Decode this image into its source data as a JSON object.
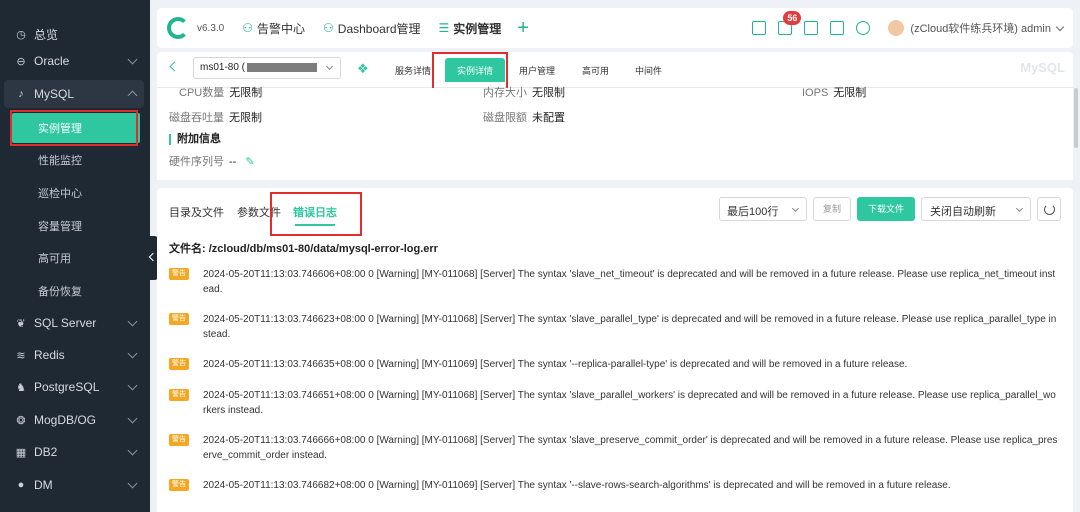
{
  "sidebar": {
    "items": [
      {
        "label": "总览",
        "icon": "dashboard-icon"
      },
      {
        "label": "Oracle",
        "icon": "oracle-icon"
      },
      {
        "label": "MySQL",
        "icon": "mysql-icon"
      },
      {
        "label": "SQL Server",
        "icon": "sqlserver-icon"
      },
      {
        "label": "Redis",
        "icon": "redis-icon"
      },
      {
        "label": "PostgreSQL",
        "icon": "postgresql-icon"
      },
      {
        "label": "MogDB/OG",
        "icon": "mogdb-icon"
      },
      {
        "label": "DB2",
        "icon": "db2-icon"
      },
      {
        "label": "DM",
        "icon": "dm-icon"
      }
    ],
    "mysql_sub": [
      "实例管理",
      "性能监控",
      "巡检中心",
      "容量管理",
      "高可用",
      "备份恢复"
    ]
  },
  "header": {
    "version": "v6.3.0",
    "links": [
      "告警中心",
      "Dashboard管理",
      "实例管理"
    ],
    "notification_count": "56",
    "user": "(zCloud软件练兵环境) admin"
  },
  "tabbar": {
    "instance": "ms01-80 (",
    "tabs": [
      "服务详情",
      "实例详情",
      "用户管理",
      "高可用",
      "中间件"
    ],
    "watermark": "MySQL"
  },
  "info": {
    "cpu_label": "CPU数量",
    "cpu_value": "无限制",
    "mem_label": "内存大小",
    "mem_value": "无限制",
    "iops_label": "IOPS",
    "iops_value": "无限制",
    "disk_label": "磁盘吞吐量",
    "disk_value": "无限制",
    "quota_label": "磁盘限额",
    "quota_value": "未配置",
    "extra_title": "附加信息",
    "serial_label": "硬件序列号",
    "serial_value": "--"
  },
  "log": {
    "tabs": [
      "目录及文件",
      "参数文件",
      "错误日志"
    ],
    "lines_select": "最后100行",
    "copy_label": "复制",
    "download_label": "下载文件",
    "refresh_select": "关闭自动刷新",
    "filename_label": "文件名:",
    "filename": "/zcloud/db/ms01-80/data/mysql-error-log.err",
    "tag": "警告",
    "entries": [
      "2024-05-20T11:13:03.746606+08:00 0 [Warning] [MY-011068] [Server] The syntax 'slave_net_timeout' is deprecated and will be removed in a future release. Please use replica_net_timeout instead.",
      "2024-05-20T11:13:03.746623+08:00 0 [Warning] [MY-011068] [Server] The syntax 'slave_parallel_type' is deprecated and will be removed in a future release. Please use replica_parallel_type instead.",
      "2024-05-20T11:13:03.746635+08:00 0 [Warning] [MY-011069] [Server] The syntax '--replica-parallel-type' is deprecated and will be removed in a future release.",
      "2024-05-20T11:13:03.746651+08:00 0 [Warning] [MY-011068] [Server] The syntax 'slave_parallel_workers' is deprecated and will be removed in a future release. Please use replica_parallel_workers instead.",
      "2024-05-20T11:13:03.746666+08:00 0 [Warning] [MY-011068] [Server] The syntax 'slave_preserve_commit_order' is deprecated and will be removed in a future release. Please use replica_preserve_commit_order instead.",
      "2024-05-20T11:13:03.746682+08:00 0 [Warning] [MY-011069] [Server] The syntax '--slave-rows-search-algorithms' is deprecated and will be removed in a future release."
    ]
  },
  "colors": {
    "accent": "#2ec7a0",
    "sidebar_bg": "#1f2933",
    "warning": "#f5a623",
    "highlight": "#e02e2e"
  }
}
